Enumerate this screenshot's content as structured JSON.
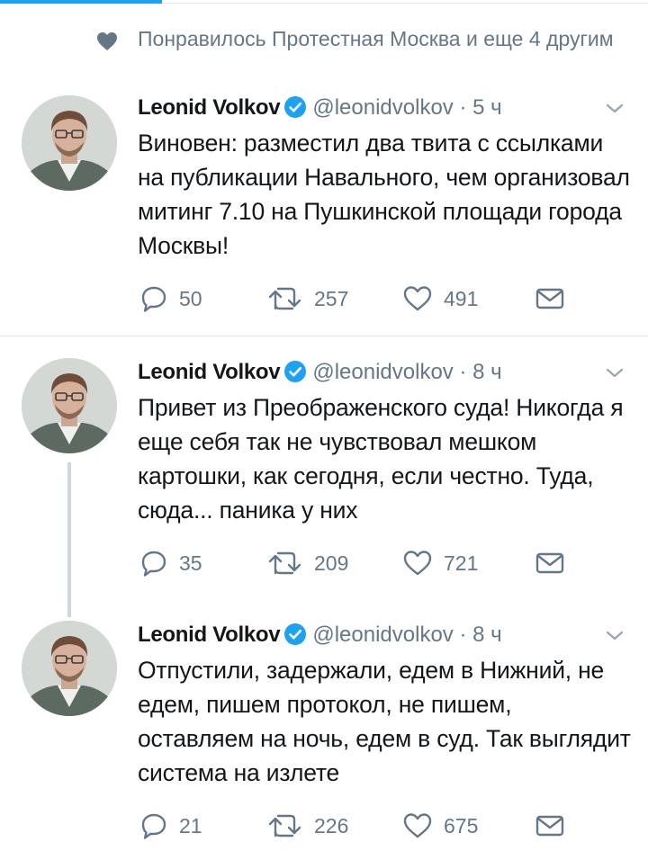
{
  "social_context": {
    "text": "Понравилось Протестная Москва и еще 4 другим",
    "icon": "heart-icon"
  },
  "colors": {
    "accent": "#1da1f2",
    "secondary_text": "#657786",
    "icon_gray": "#657786",
    "thread_line": "#ccd6dd"
  },
  "tweets": [
    {
      "name": "Leonid Volkov",
      "handle": "@leonidvolkov",
      "separator": "·",
      "time": "5 ч",
      "text": "Виновен: разместил два твита с ссылками на публикации Навального, чем организовал митинг 7.10 на Пушкинской площади города Москвы!",
      "replies": "50",
      "retweets": "257",
      "likes": "491"
    },
    {
      "name": "Leonid Volkov",
      "handle": "@leonidvolkov",
      "separator": "·",
      "time": "8 ч",
      "text": "Привет из Преображенского суда! Никогда я еще себя так не чувствовал мешком картошки, как сегодня, если честно. Туда, сюда... паника у них",
      "replies": "35",
      "retweets": "209",
      "likes": "721"
    },
    {
      "name": "Leonid Volkov",
      "handle": "@leonidvolkov",
      "separator": "·",
      "time": "8 ч",
      "text": "Отпустили, задержали, едем в Нижний, не едем, пишем протокол, не пишем, оставляем на ночь, едем в суд. Так выглядит система на излете",
      "replies": "21",
      "retweets": "226",
      "likes": "675"
    }
  ]
}
